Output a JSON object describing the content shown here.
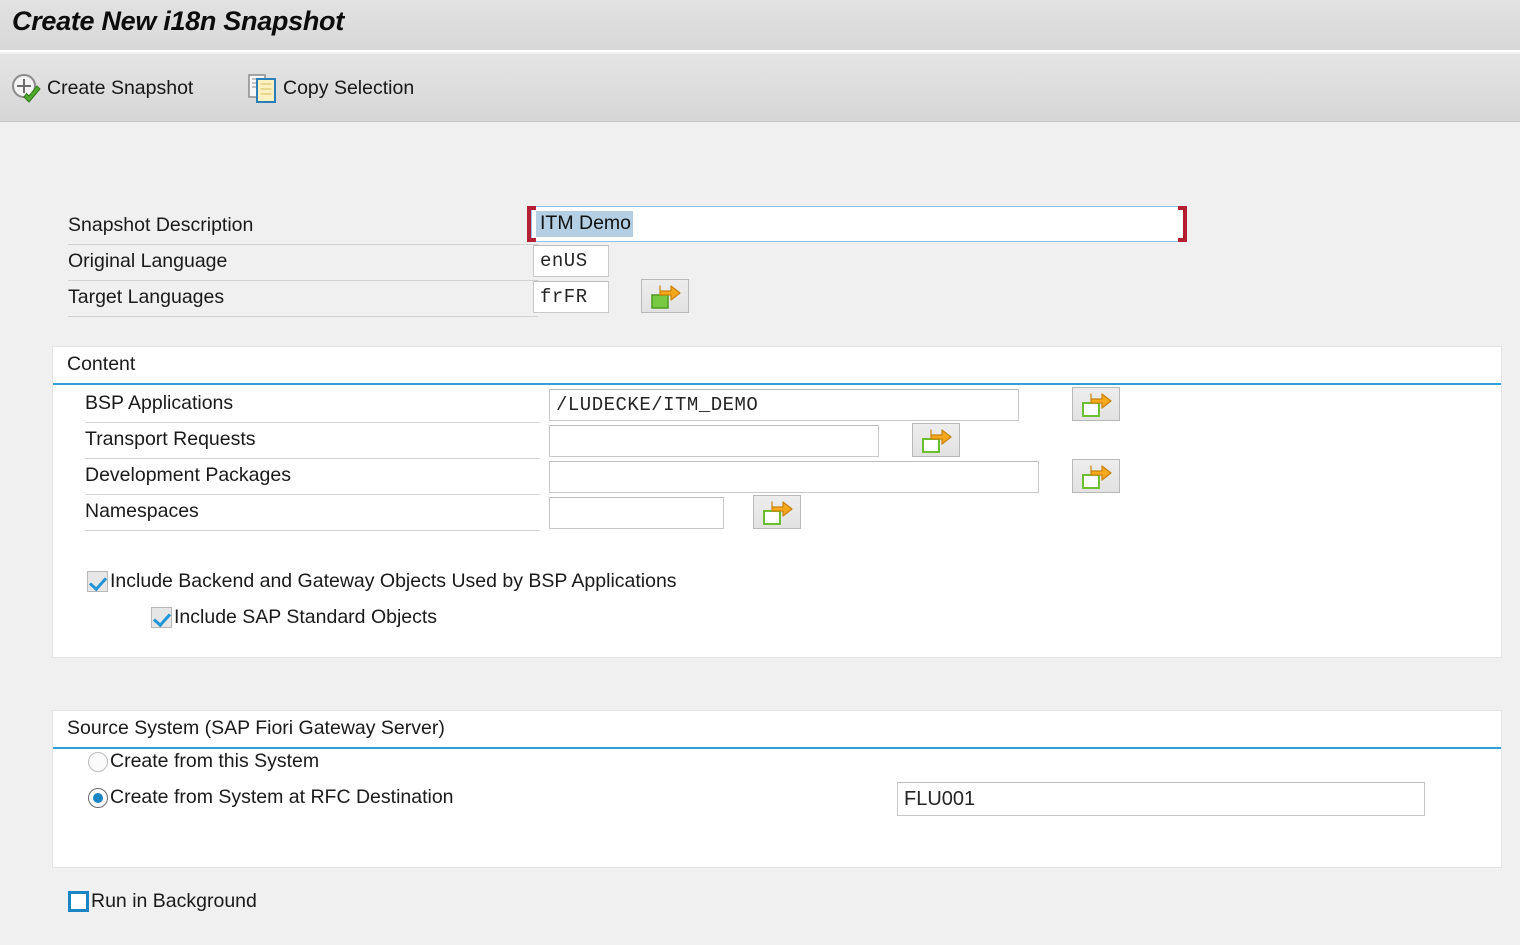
{
  "window": {
    "title": "Create New i18n Snapshot"
  },
  "toolbar": {
    "buttons": [
      {
        "label": "Create Snapshot",
        "icon": "create-snapshot-icon"
      },
      {
        "label": "Copy Selection",
        "icon": "copy-selection-icon"
      }
    ]
  },
  "header_form": {
    "description": {
      "label": "Snapshot Description",
      "value": "ITM Demo",
      "selected": true,
      "focused": true
    },
    "original_language": {
      "label": "Original Language",
      "value": "enUS"
    },
    "target_languages": {
      "label": "Target Languages",
      "value": "frFR",
      "value_help_icon": "multi-select-arrow-icon"
    }
  },
  "content_panel": {
    "title": "Content",
    "rows": [
      {
        "label": "BSP Applications",
        "value": "/LUDECKE/ITM_DEMO",
        "value_help_icon": "multi-select-arrow-icon"
      },
      {
        "label": "Transport Requests",
        "value": "",
        "value_help_icon": "multi-select-arrow-icon"
      },
      {
        "label": "Development Packages",
        "value": "",
        "value_help_icon": "multi-select-arrow-icon"
      },
      {
        "label": "Namespaces",
        "value": "",
        "value_help_icon": "multi-select-arrow-icon"
      }
    ],
    "checkboxes": [
      {
        "label": "Include Backend and Gateway Objects Used by BSP Applications",
        "checked": true
      },
      {
        "label": "Include SAP Standard Objects",
        "checked": true
      }
    ]
  },
  "source_system_panel": {
    "title": "Source System (SAP Fiori Gateway Server)",
    "options": [
      {
        "label": "Create from this System",
        "selected": false
      },
      {
        "label": "Create from System at RFC Destination",
        "selected": true
      }
    ],
    "rfc_destination": {
      "value": "FLU001"
    }
  },
  "footer": {
    "run_in_background": {
      "label": "Run in Background",
      "checked": false
    }
  },
  "colors": {
    "panel_rule": "#2f9fd8",
    "focus_bracket": "#b51f33",
    "selection": "#b4cfe4",
    "checkbox_check": "#2196d6",
    "radio_dot": "#1b84c4",
    "icon_arrow": "#f5a623",
    "icon_green": "#6cbf2f",
    "titlebar": "#dcdcdc",
    "body": "#f0f0f0"
  }
}
